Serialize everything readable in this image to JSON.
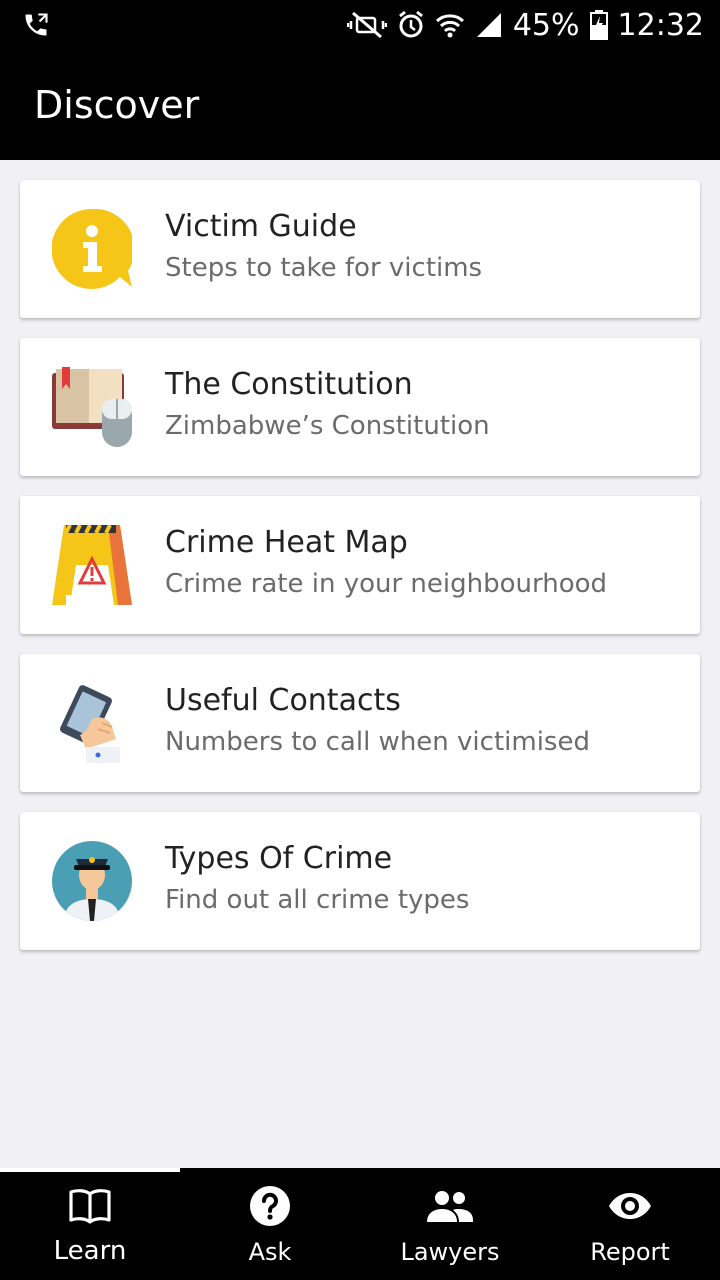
{
  "status_bar": {
    "battery": "45%",
    "time": "12:32",
    "icons": [
      "phone-call-icon",
      "mute-icon",
      "alarm-icon",
      "wifi-icon",
      "signal-icon",
      "battery-icon"
    ]
  },
  "app_bar": {
    "title": "Discover"
  },
  "cards": [
    {
      "title": "Victim Guide",
      "subtitle": "Steps to take for victims",
      "icon": "info-bubble-icon"
    },
    {
      "title": "The Constitution",
      "subtitle": "Zimbabwe’s Constitution",
      "icon": "book-mouse-icon"
    },
    {
      "title": "Crime Heat Map",
      "subtitle": "Crime rate in your neighbourhood",
      "icon": "warning-sign-icon"
    },
    {
      "title": "Useful Contacts",
      "subtitle": "Numbers to call when victimised",
      "icon": "phone-hand-icon"
    },
    {
      "title": "Types Of Crime",
      "subtitle": "Find out all crime types",
      "icon": "police-officer-icon"
    }
  ],
  "bottom_nav": [
    {
      "label": "Learn",
      "icon": "book-icon",
      "active": true
    },
    {
      "label": "Ask",
      "icon": "help-circle-icon",
      "active": false
    },
    {
      "label": "Lawyers",
      "icon": "people-icon",
      "active": false
    },
    {
      "label": "Report",
      "icon": "eye-icon",
      "active": false
    }
  ],
  "colors": {
    "bar": "#000000",
    "background": "#f0f0f5",
    "card": "#ffffff",
    "title_text": "#222222",
    "subtitle_text": "#6b6b6b"
  }
}
